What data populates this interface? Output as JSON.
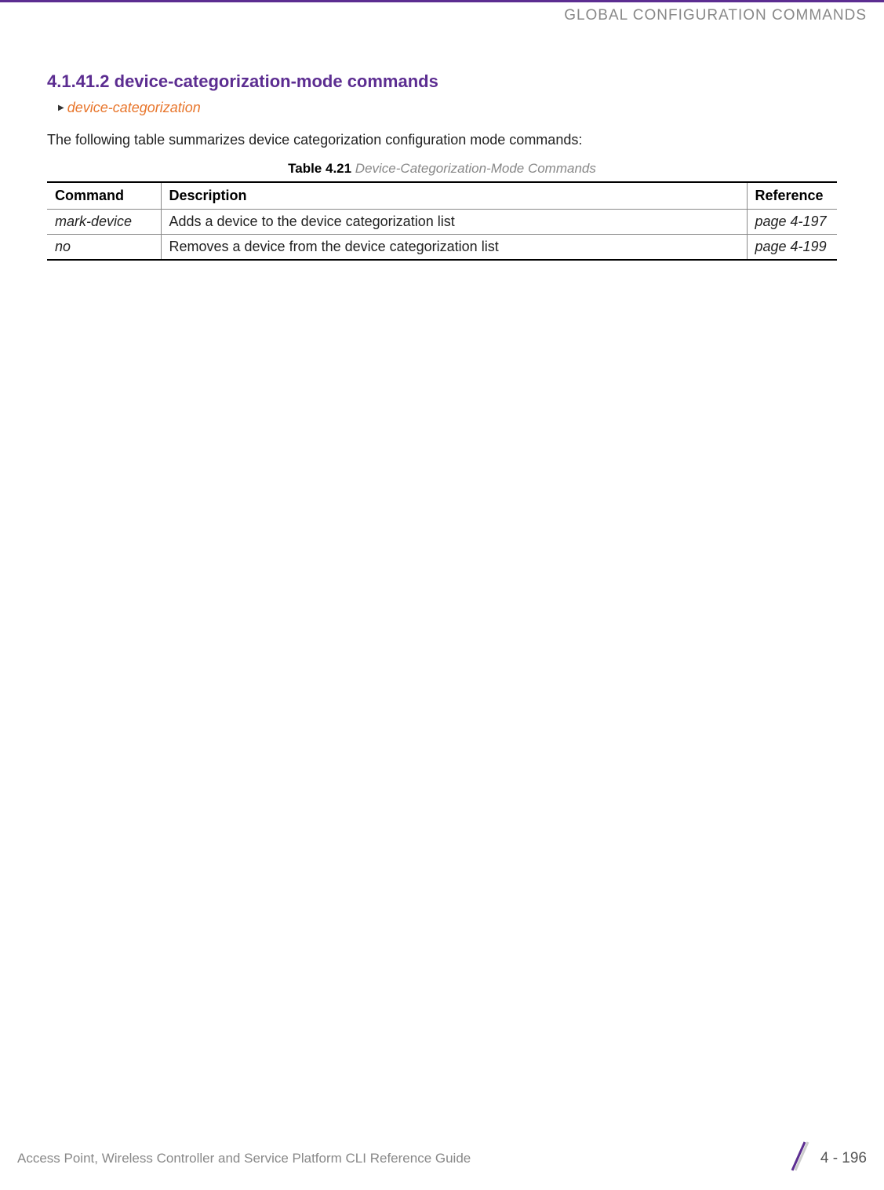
{
  "header": {
    "title": "GLOBAL CONFIGURATION COMMANDS"
  },
  "section": {
    "heading": "4.1.41.2 device-categorization-mode commands",
    "breadcrumb": "device-categorization",
    "intro": "The following table summarizes device categorization configuration mode commands:",
    "table_caption_bold": "Table 4.21",
    "table_caption_italic": " Device-Categorization-Mode Commands"
  },
  "table": {
    "headers": {
      "command": "Command",
      "description": "Description",
      "reference": "Reference"
    },
    "rows": [
      {
        "command": "mark-device",
        "description": "Adds a device to the device categorization list",
        "reference": "page 4-197"
      },
      {
        "command": "no",
        "description": "Removes a device from the device categorization list",
        "reference": "page 4-199"
      }
    ]
  },
  "footer": {
    "guide": "Access Point, Wireless Controller and Service Platform CLI Reference Guide",
    "page": "4 - 196"
  }
}
